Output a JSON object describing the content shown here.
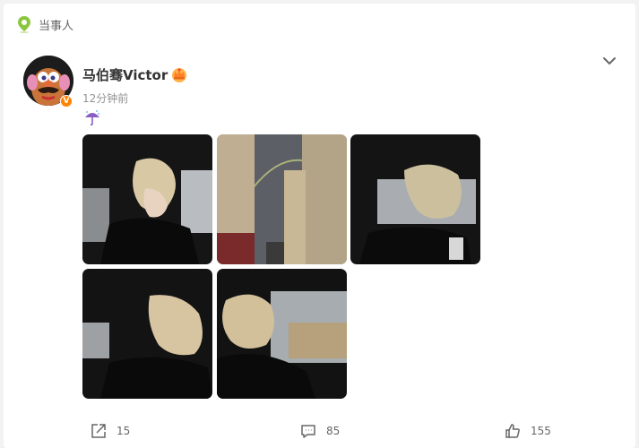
{
  "header": {
    "label": "当事人"
  },
  "post": {
    "author": "马伯骞Victor",
    "time": "12分钟前",
    "verified_badge": "V",
    "text_emoji": "umbrella-rain-emoji",
    "photos": [
      {
        "name": "photo-1"
      },
      {
        "name": "photo-2"
      },
      {
        "name": "photo-3"
      },
      {
        "name": "photo-4"
      },
      {
        "name": "photo-5"
      }
    ]
  },
  "actions": {
    "share_count": "15",
    "comment_count": "85",
    "like_count": "155"
  },
  "colors": {
    "accent": "#ff8200",
    "pin": "#8cc63f",
    "text": "#333333",
    "muted": "#939393"
  }
}
